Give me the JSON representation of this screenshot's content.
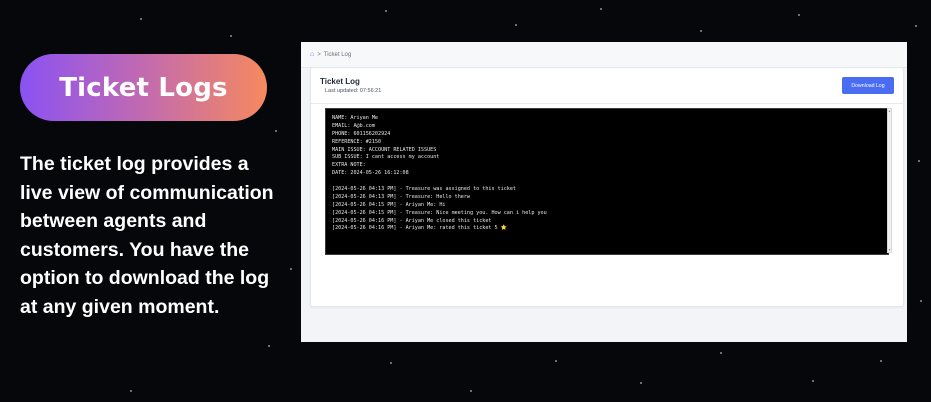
{
  "banner": {
    "title": "Ticket Logs",
    "description": "The ticket log provides a live view of communication between agents and customers. You have the option to download the log at any given moment."
  },
  "app": {
    "breadcrumb": {
      "home_icon": "home-icon",
      "separator": ">",
      "current": "Ticket Log"
    },
    "card": {
      "title": "Ticket Log",
      "last_updated": "Last updated: 07:56:21",
      "download_label": "Download Log"
    },
    "log_lines": [
      "NAME: Ariyan Me",
      "EMAIL: A@b.com",
      "PHONE: 601156202924",
      "REFERENCE: #2150",
      "MAIN ISSUE: ACCOUNT RELATED ISSUES",
      "SUB ISSUE: I cant access my account",
      "EXTRA NOTE:",
      "DATE: 2024-05-26 16:12:08",
      "",
      "[2024-05-26 04:13 PM] - Treasure was assigned to this ticket",
      "[2024-05-26 04:13 PM] - Treasure: Hello therw",
      "[2024-05-26 04:15 PM] - Ariyan Me: Hi",
      "[2024-05-26 04:15 PM] - Treasure: Nice meeting you. How can i help you",
      "[2024-05-26 04:16 PM] - Ariyan Me closed this ticket",
      "[2024-05-26 04:16 PM] - Ariyan Me: rated this ticket 5 ⭐"
    ]
  },
  "colors": {
    "page_background": "#06070b",
    "pill_gradient_start": "#8a52f4",
    "pill_gradient_end": "#f6895e",
    "button_blue": "#4a6cf0",
    "terminal_background": "#000000"
  }
}
